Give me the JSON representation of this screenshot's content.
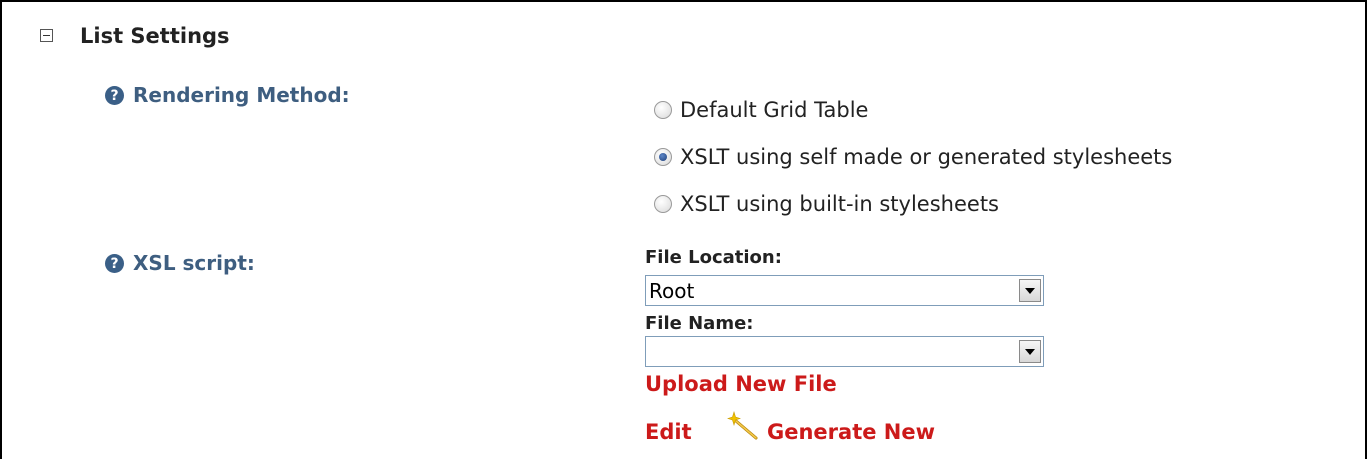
{
  "section": {
    "title": "List Settings",
    "toggle_icon": "collapse-minus-icon"
  },
  "rendering_method": {
    "label": "Rendering Method:",
    "help_icon": "help-question-icon",
    "options": [
      {
        "label": "Default Grid Table",
        "checked": false
      },
      {
        "label": "XSLT using self made or generated stylesheets",
        "checked": true
      },
      {
        "label": "XSLT using built-in stylesheets",
        "checked": false
      }
    ]
  },
  "xsl_script": {
    "label": "XSL script:",
    "help_icon": "help-question-icon",
    "file_location": {
      "label": "File Location:",
      "value": "Root"
    },
    "file_name": {
      "label": "File Name:",
      "value": ""
    },
    "upload_link": "Upload New File",
    "edit_link": "Edit",
    "generate_link": "Generate New",
    "generate_icon": "magic-wand-icon"
  },
  "colors": {
    "label_blue": "#3e5e80",
    "link_red": "#cc1a1a",
    "help_icon_bg": "#3a5f87"
  }
}
